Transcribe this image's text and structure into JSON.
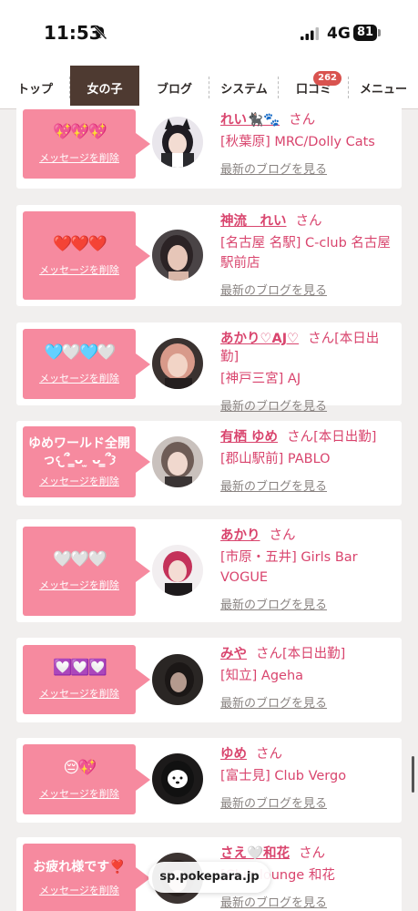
{
  "status_bar": {
    "time": "11:53",
    "network": "4G",
    "battery": "81"
  },
  "nav": {
    "tabs": [
      {
        "label": "トップ"
      },
      {
        "label": "女の子"
      },
      {
        "label": "ブログ"
      },
      {
        "label": "システム"
      },
      {
        "label": "口コミ",
        "badge": "262"
      },
      {
        "label": "メニュー"
      }
    ]
  },
  "common": {
    "delete_label": "メッセージを削除",
    "blog_label": "最新のブログを見る",
    "san": "さん"
  },
  "messages": [
    {
      "emoji": "💖💖💖",
      "name": "れい🐈‍⬛🐾",
      "status": "",
      "shop": "[秋葉原] MRC/Dolly Cats"
    },
    {
      "emoji": "❤️❤️❤️",
      "name": "神流　れい",
      "status": "",
      "shop": "[名古屋 名駅] C-club 名古屋駅前店"
    },
    {
      "emoji": "🩵🤍🩵🤍",
      "name": "あかり♡AJ♡",
      "status": "[本日出勤]",
      "shop": "[神戸三宮] AJ"
    },
    {
      "text": "ゆめワールド全開っ𐔌՞ ̳ᴗ ̫ ᴗ ̳՞𐦯",
      "name": "有栖 ゆめ",
      "status": "[本日出勤]",
      "shop": "[郡山駅前] PABLO"
    },
    {
      "emoji": "🤍🤍🤍",
      "name": "あかり",
      "status": "",
      "shop": "[市原・五井] Girls Bar VOGUE"
    },
    {
      "emoji": "💟💟💟",
      "name": "みや",
      "status": "[本日出勤]",
      "shop": "[知立] Ageha"
    },
    {
      "emoji": "😔💖",
      "name": "ゆめ",
      "status": "",
      "shop": "[富士見] Club Vergo"
    },
    {
      "text": "お疲れ様です❣️",
      "name": "さえ🤍和花",
      "status": "",
      "shop": "[Club lounge 和花"
    }
  ],
  "url_bar": {
    "domain": "sp.pokepara.jp"
  },
  "colors": {
    "accent": "#d9456e",
    "bubble": "#f68a9f",
    "nav_active": "#4e3a31",
    "badge": "#d9534f"
  }
}
